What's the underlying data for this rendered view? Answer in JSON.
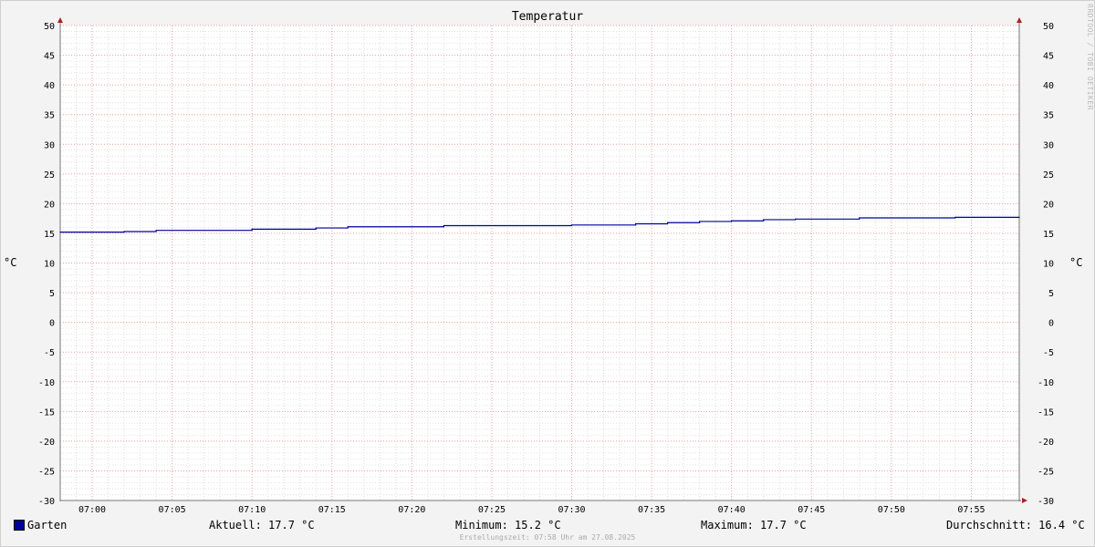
{
  "watermark": "RRDTOOL / TOBI OETIKER",
  "chart_data": {
    "type": "line",
    "title": "Temperatur",
    "ylabel": "°C",
    "ylabel_right": "°C",
    "ylim": [
      -30,
      50
    ],
    "yticks": [
      -30,
      -25,
      -20,
      -15,
      -10,
      -5,
      0,
      5,
      10,
      15,
      20,
      25,
      30,
      35,
      40,
      45,
      50
    ],
    "x_range": [
      "06:58",
      "07:58"
    ],
    "xticks": [
      "07:00",
      "07:05",
      "07:10",
      "07:15",
      "07:20",
      "07:25",
      "07:30",
      "07:35",
      "07:40",
      "07:45",
      "07:50",
      "07:55"
    ],
    "grid": true,
    "series": [
      {
        "name": "Garten",
        "color": "#00009c",
        "x": [
          "06:58",
          "07:02",
          "07:04",
          "07:10",
          "07:14",
          "07:16",
          "07:22",
          "07:30",
          "07:34",
          "07:36",
          "07:38",
          "07:40",
          "07:42",
          "07:44",
          "07:48",
          "07:54",
          "07:58"
        ],
        "values": [
          15.2,
          15.3,
          15.5,
          15.7,
          15.9,
          16.1,
          16.3,
          16.4,
          16.6,
          16.8,
          17.0,
          17.1,
          17.3,
          17.4,
          17.6,
          17.7,
          17.7
        ]
      }
    ]
  },
  "legend": {
    "series_name": "Garten",
    "aktuell": "Aktuell: 17.7 °C",
    "minimum": "Minimum: 15.2 °C",
    "maximum": "Maximum: 17.7 °C",
    "durchschnitt": "Durchschnitt: 16.4 °C"
  },
  "footer": "Erstellungszeit: 07:58 Uhr am 27.08.2025"
}
